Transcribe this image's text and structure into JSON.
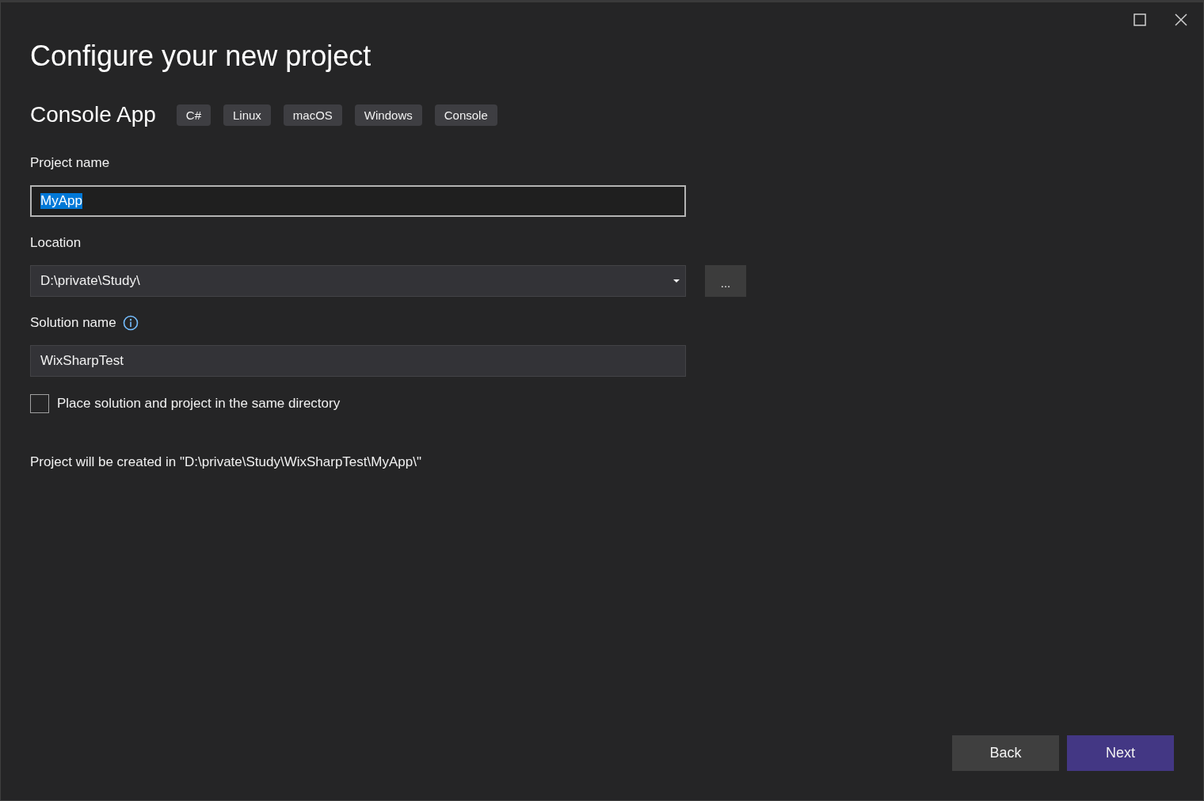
{
  "title": "Configure your new project",
  "template": {
    "name": "Console App",
    "tags": [
      "C#",
      "Linux",
      "macOS",
      "Windows",
      "Console"
    ]
  },
  "fields": [
    {
      "kind": "text",
      "label": "Project name",
      "value": "MyApp",
      "value_selected": true,
      "focused": true
    },
    {
      "kind": "combo",
      "label": "Location",
      "value": "D:\\private\\Study\\",
      "browse_button": "..."
    },
    {
      "kind": "text",
      "label": "Solution name",
      "value": "WixSharpTest",
      "value_selected": false,
      "focused": false,
      "info": true
    }
  ],
  "checkbox": {
    "label": "Place solution and project in the same directory",
    "checked": false
  },
  "summary": "Project will be created in \"D:\\private\\Study\\WixSharpTest\\MyApp\\\"",
  "buttons": [
    {
      "label": "Back",
      "primary": false
    },
    {
      "label": "Next",
      "primary": true
    }
  ]
}
